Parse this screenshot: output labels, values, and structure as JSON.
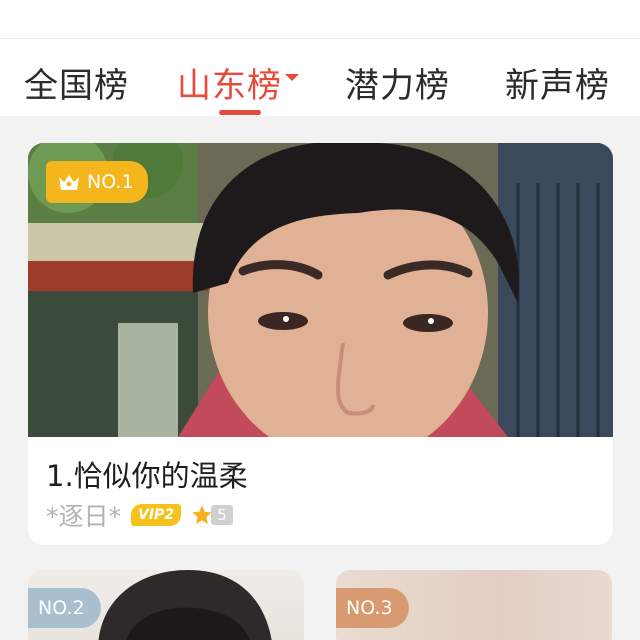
{
  "header": {
    "tabs": [
      {
        "label": "全国榜"
      },
      {
        "label": "山东榜"
      },
      {
        "label": "潜力榜"
      },
      {
        "label": "新声榜"
      }
    ],
    "active_tab": "山东榜",
    "accent_color": "#e64a3b"
  },
  "featured": {
    "rank_label": "NO.1",
    "rank_icon": "crown-icon",
    "title": "1.恰似你的温柔",
    "username": "*逐日*",
    "vip_label": "VIP2",
    "level": "5",
    "badge_color": "#f5b51c"
  },
  "others": [
    {
      "rank_label": "NO.2",
      "badge_color": "#a9bfce"
    },
    {
      "rank_label": "NO.3",
      "badge_color": "#d99a71"
    }
  ]
}
